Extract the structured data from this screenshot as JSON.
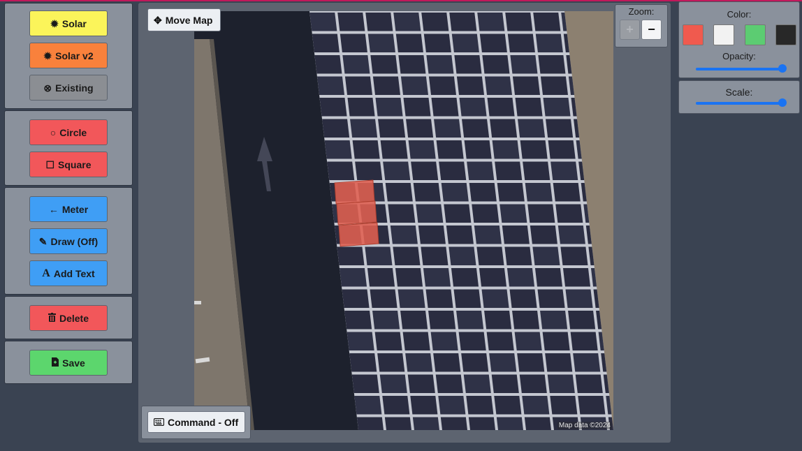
{
  "toolbar": {
    "solar": {
      "icon": "sun-icon",
      "label": "Solar"
    },
    "solar_v2": {
      "icon": "sun-icon",
      "label": "Solar v2"
    },
    "existing": {
      "icon": "x-circle-icon",
      "label": "Existing"
    },
    "circle": {
      "icon": "circle-icon",
      "label": "Circle"
    },
    "square": {
      "icon": "square-icon",
      "label": "Square"
    },
    "meter": {
      "icon": "arrow-left-icon",
      "label": "Meter"
    },
    "draw": {
      "icon": "pencil-icon",
      "label": "Draw (Off)"
    },
    "add_text": {
      "icon": "text-icon",
      "label": "Add Text"
    },
    "delete": {
      "icon": "trash-icon",
      "label": "Delete"
    },
    "save": {
      "icon": "save-file-icon",
      "label": "Save"
    }
  },
  "map": {
    "move_label": "Move Map",
    "command_label": "Command - Off",
    "attribution": "Map data ©2024"
  },
  "zoom": {
    "label": "Zoom:",
    "plus": "+",
    "minus": "−"
  },
  "color_panel": {
    "label": "Color:",
    "swatches": [
      "#f05a4e",
      "#f2f2f2",
      "#5ccc72",
      "#282828"
    ],
    "opacity_label": "Opacity:",
    "opacity_value": 1.0
  },
  "scale_panel": {
    "label": "Scale:",
    "value": 1.0
  },
  "colors": {
    "accent_top": "#c2185b",
    "panel_bg": "#8a919c",
    "slider": "#1a73f2",
    "panel_marker": "#e06050"
  }
}
